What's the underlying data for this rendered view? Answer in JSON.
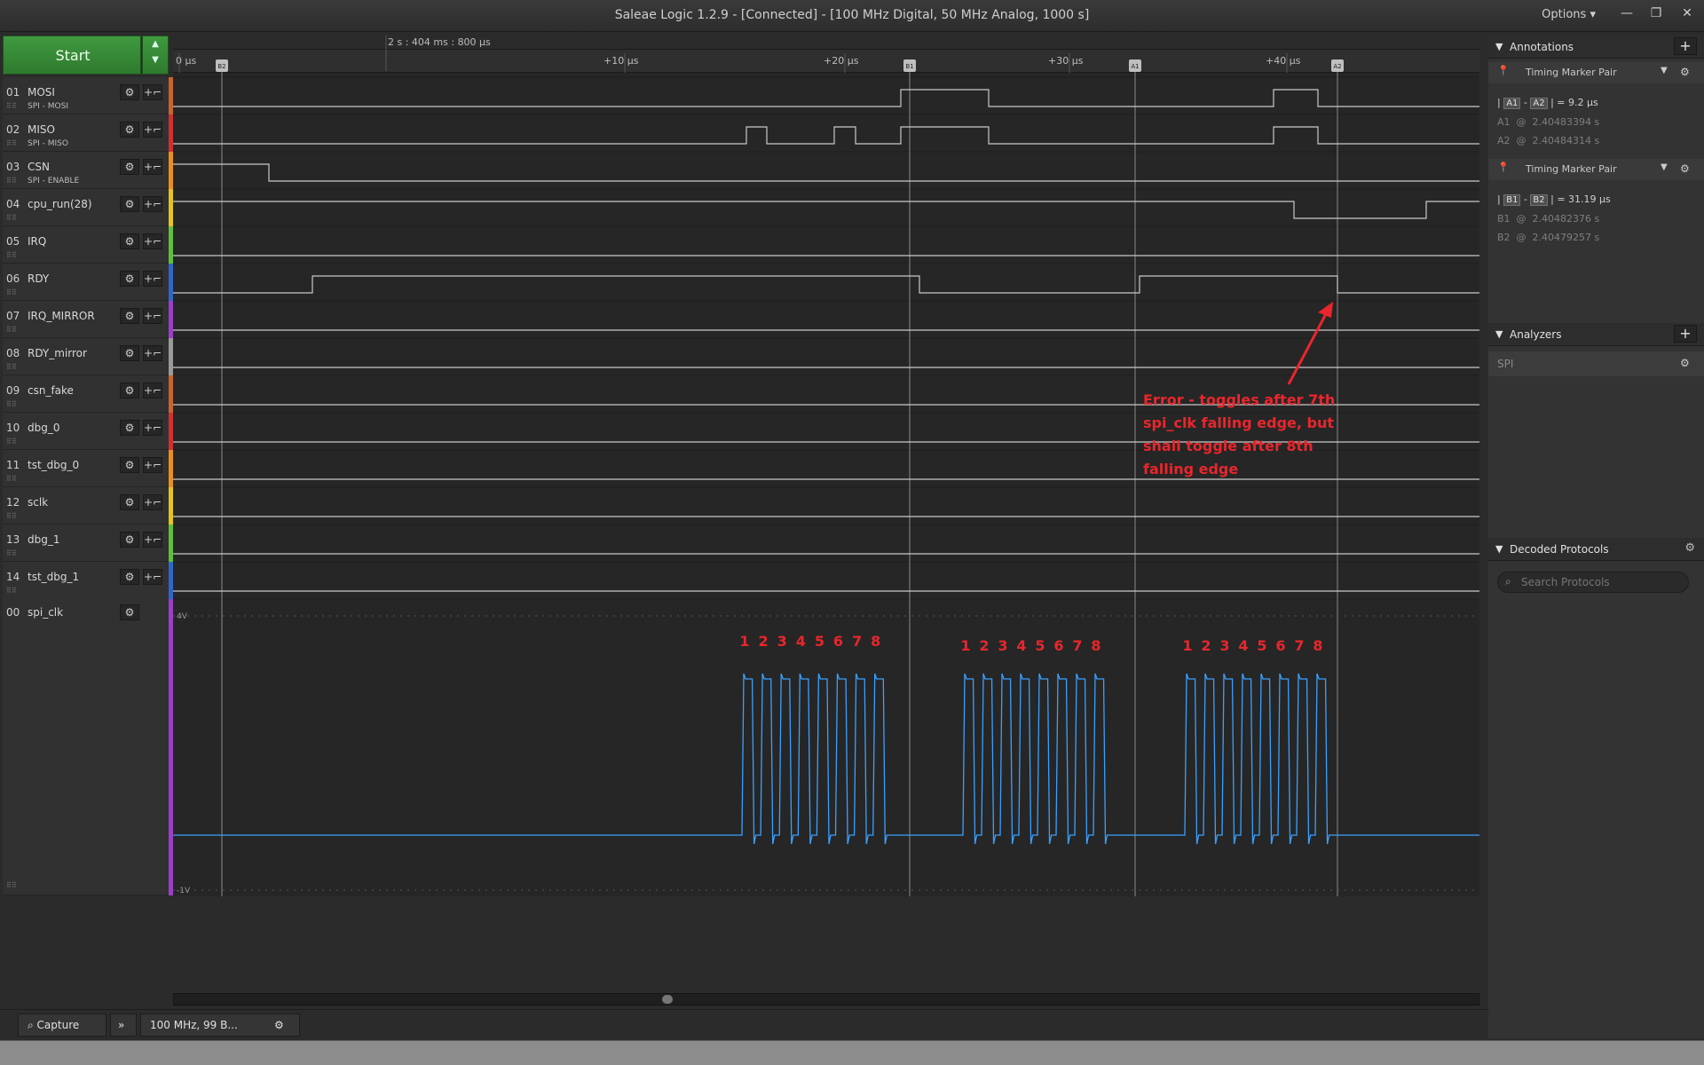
{
  "window": {
    "title": "Saleae Logic 1.2.9 - [Connected] - [100 MHz Digital, 50 MHz Analog, 1000 s]",
    "options_label": "Options",
    "minimize": "—",
    "restore": "❐",
    "close": "✕"
  },
  "toolbar": {
    "start_label": "Start",
    "time_position": "2 s : 404 ms : 800 μs",
    "time_ticks": [
      "0 μs",
      "+10 μs",
      "+20 μs",
      "+30 μs",
      "+40 μs"
    ],
    "markers": [
      "B2",
      "B1",
      "A1",
      "A2"
    ]
  },
  "channels": [
    {
      "num": "01",
      "name": "MOSI",
      "sub": "SPI - MOSI",
      "color": "#c8642d"
    },
    {
      "num": "02",
      "name": "MISO",
      "sub": "SPI - MISO",
      "color": "#d03030"
    },
    {
      "num": "03",
      "name": "CSN",
      "sub": "SPI - ENABLE",
      "color": "#e88f1f"
    },
    {
      "num": "04",
      "name": "cpu_run(28)",
      "sub": "",
      "color": "#e6c21f"
    },
    {
      "num": "05",
      "name": "IRQ",
      "sub": "",
      "color": "#5fbf3a"
    },
    {
      "num": "06",
      "name": "RDY",
      "sub": "",
      "color": "#2f66c8"
    },
    {
      "num": "07",
      "name": "IRQ_MIRROR",
      "sub": "",
      "color": "#9b3fc8"
    },
    {
      "num": "08",
      "name": "RDY_mirror",
      "sub": "",
      "color": "#9a9a9a"
    },
    {
      "num": "09",
      "name": "csn_fake",
      "sub": "",
      "color": "#c8642d"
    },
    {
      "num": "10",
      "name": "dbg_0",
      "sub": "",
      "color": "#d03030"
    },
    {
      "num": "11",
      "name": "tst_dbg_0",
      "sub": "",
      "color": "#e88f1f"
    },
    {
      "num": "12",
      "name": "sclk",
      "sub": "",
      "color": "#e6c21f"
    },
    {
      "num": "13",
      "name": "dbg_1",
      "sub": "",
      "color": "#5fbf3a"
    },
    {
      "num": "14",
      "name": "tst_dbg_1",
      "sub": "",
      "color": "#2f66c8"
    }
  ],
  "analog_channel": {
    "num": "00",
    "name": "spi_clk",
    "color": "#9b3fc8",
    "top_label": "4V",
    "bottom_label": "-1V"
  },
  "annotation": {
    "line1": "Error - toggles after 7th",
    "line2": "spi_clk falling edge, but",
    "line3": "shall toggle after 8th",
    "line4": "falling edge",
    "color": "#e8262c"
  },
  "pulse_numbers": [
    "1",
    "2",
    "3",
    "4",
    "5",
    "6",
    "7",
    "8"
  ],
  "annotations_panel": {
    "title": "Annotations",
    "pairs": [
      {
        "label": "Timing Marker Pair",
        "m1": "A1",
        "m2": "A2",
        "delta": "= 9.2 μs",
        "v1_name": "A1",
        "v1": "2.40483394 s",
        "v2_name": "A2",
        "v2": "2.40484314 s"
      },
      {
        "label": "Timing Marker Pair",
        "m1": "B1",
        "m2": "B2",
        "delta": "= 31.19 μs",
        "v1_name": "B1",
        "v1": "2.40482376 s",
        "v2_name": "B2",
        "v2": "2.40479257 s"
      }
    ]
  },
  "analyzers_panel": {
    "title": "Analyzers",
    "items": [
      "SPI"
    ]
  },
  "decoded_panel": {
    "title": "Decoded Protocols",
    "search_placeholder": "Search Protocols"
  },
  "bottom_tabs": {
    "capture": "Capture",
    "session": "100 MHz, 99 B..."
  }
}
